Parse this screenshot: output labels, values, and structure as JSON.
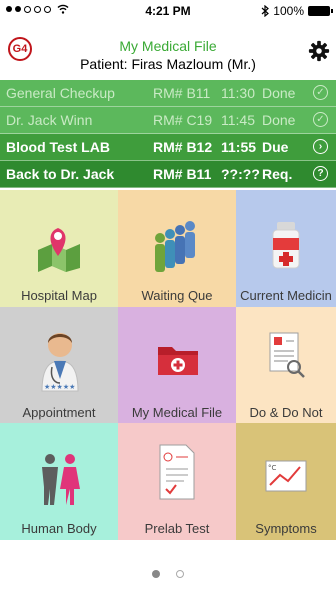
{
  "status_bar": {
    "time": "4:21 PM",
    "battery": "100%"
  },
  "header": {
    "logo": "G4",
    "title": "My Medical File",
    "patient": "Patient: Firas Mazloum (Mr.)"
  },
  "visits": [
    {
      "name": "General Checkup",
      "room": "RM# B11",
      "time": "11:30",
      "status": "Done",
      "state": "done",
      "icon": "check-icon"
    },
    {
      "name": "Dr. Jack Winn",
      "room": "RM# C19",
      "time": "11:45",
      "status": "Done",
      "state": "done",
      "icon": "check-icon"
    },
    {
      "name": "Blood Test LAB",
      "room": "RM# B12",
      "time": "11:55",
      "status": "Due",
      "state": "active",
      "icon": "chevron-right-icon"
    },
    {
      "name": "Back to Dr. Jack",
      "room": "RM# B11",
      "time": "??:??",
      "status": "Req.",
      "state": "active",
      "icon": "question-icon"
    }
  ],
  "tiles": [
    {
      "label": "Hospital Map",
      "icon": "map-pin-icon",
      "bg": "#e8ecb5"
    },
    {
      "label": "Waiting Que",
      "icon": "queue-people-icon",
      "bg": "#f7d9a6"
    },
    {
      "label": "Current Medicin",
      "icon": "medicine-bottle-icon",
      "bg": "#b7c9ec"
    },
    {
      "label": "Appointment",
      "icon": "doctor-icon",
      "bg": "#cfcfcf"
    },
    {
      "label": "My Medical File",
      "icon": "medical-folder-icon",
      "bg": "#d9b1e0"
    },
    {
      "label": "Do & Do Not",
      "icon": "checklist-icon",
      "bg": "#fce4c2"
    },
    {
      "label": "Human Body",
      "icon": "human-body-icon",
      "bg": "#a7f0dc"
    },
    {
      "label": "Prelab Test",
      "icon": "prelab-test-icon",
      "bg": "#f6c9c9"
    },
    {
      "label": "Symptoms",
      "icon": "symptoms-chart-icon",
      "bg": "#d9c378"
    }
  ],
  "pager": {
    "pages": 2,
    "current": 1
  }
}
